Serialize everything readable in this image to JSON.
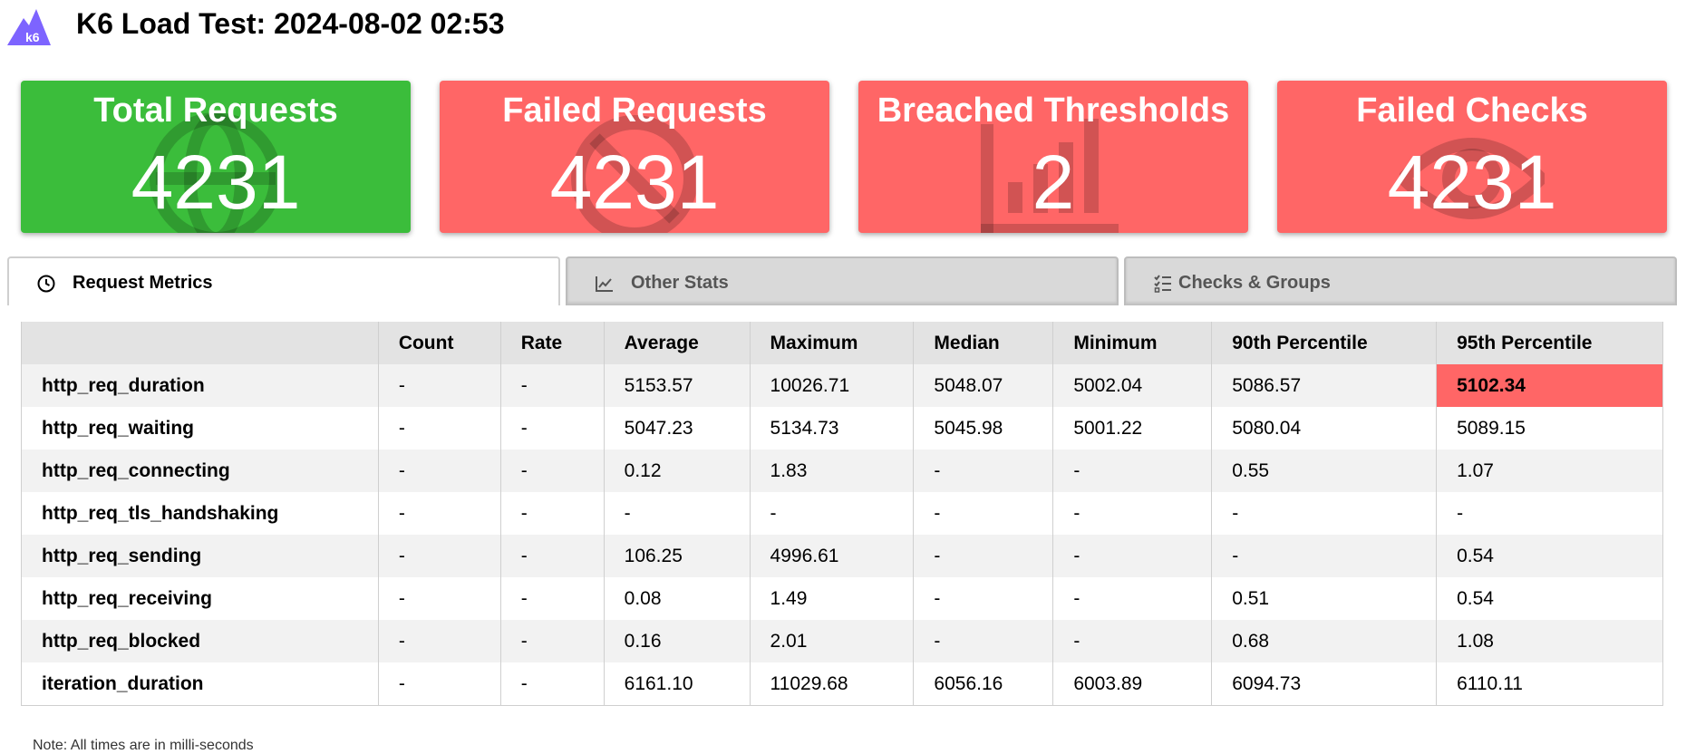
{
  "header": {
    "logo_text": "k6",
    "title": "K6 Load Test: 2024-08-02 02:53"
  },
  "cards": [
    {
      "title": "Total Requests",
      "value": "4231",
      "status": "passed",
      "icon": "globe-icon",
      "color": "#3bbd3b"
    },
    {
      "title": "Failed Requests",
      "value": "4231",
      "status": "failed",
      "icon": "ban-icon",
      "color": "#ff6666"
    },
    {
      "title": "Breached Thresholds",
      "value": "2",
      "status": "failed",
      "icon": "bar-chart-icon",
      "color": "#ff6666"
    },
    {
      "title": "Failed Checks",
      "value": "4231",
      "status": "failed",
      "icon": "eye-icon",
      "color": "#ff6666"
    }
  ],
  "tabs": [
    {
      "label": "Request Metrics",
      "icon": "clock-icon",
      "active": true
    },
    {
      "label": "Other Stats",
      "icon": "line-chart-icon",
      "active": false
    },
    {
      "label": "Checks & Groups",
      "icon": "checklist-icon",
      "active": false
    }
  ],
  "table": {
    "columns": [
      "",
      "Count",
      "Rate",
      "Average",
      "Maximum",
      "Median",
      "Minimum",
      "90th Percentile",
      "95th Percentile"
    ],
    "rows": [
      [
        "http_req_duration",
        "-",
        "-",
        "5153.57",
        "10026.71",
        "5048.07",
        "5002.04",
        "5086.57",
        "5102.34"
      ],
      [
        "http_req_waiting",
        "-",
        "-",
        "5047.23",
        "5134.73",
        "5045.98",
        "5001.22",
        "5080.04",
        "5089.15"
      ],
      [
        "http_req_connecting",
        "-",
        "-",
        "0.12",
        "1.83",
        "-",
        "-",
        "0.55",
        "1.07"
      ],
      [
        "http_req_tls_handshaking",
        "-",
        "-",
        "-",
        "-",
        "-",
        "-",
        "-",
        "-"
      ],
      [
        "http_req_sending",
        "-",
        "-",
        "106.25",
        "4996.61",
        "-",
        "-",
        "-",
        "0.54"
      ],
      [
        "http_req_receiving",
        "-",
        "-",
        "0.08",
        "1.49",
        "-",
        "-",
        "0.51",
        "0.54"
      ],
      [
        "http_req_blocked",
        "-",
        "-",
        "0.16",
        "2.01",
        "-",
        "-",
        "0.68",
        "1.08"
      ],
      [
        "iteration_duration",
        "-",
        "-",
        "6161.10",
        "11029.68",
        "6056.16",
        "6003.89",
        "6094.73",
        "6110.11"
      ]
    ],
    "breached_cells": [
      [
        0,
        8
      ]
    ]
  },
  "note": "Note: All times are in milli-seconds",
  "colors": {
    "passed": "#3bbd3b",
    "failed": "#ff6666",
    "logo": "#7d64ff"
  }
}
